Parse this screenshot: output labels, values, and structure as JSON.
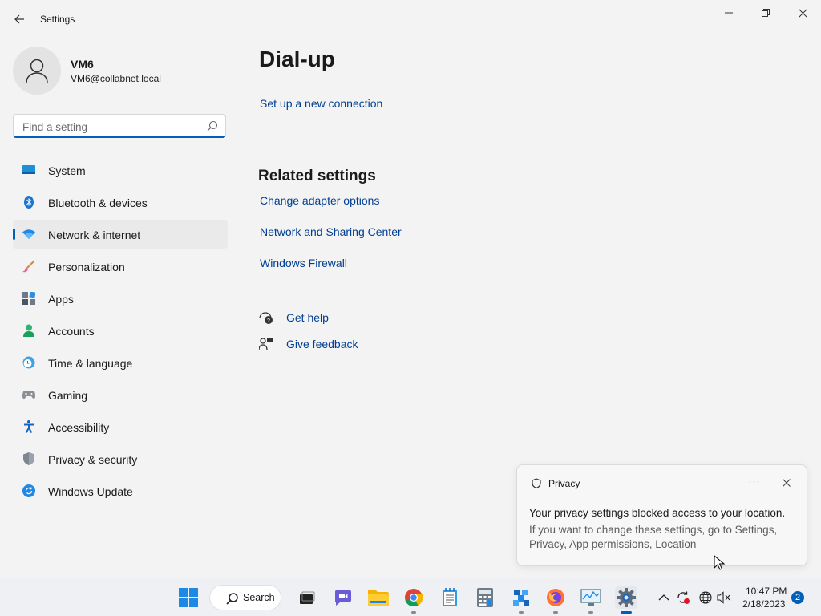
{
  "window": {
    "title": "Settings"
  },
  "profile": {
    "name": "VM6",
    "email": "VM6@collabnet.local"
  },
  "search": {
    "placeholder": "Find a setting",
    "value": ""
  },
  "sidebar": {
    "items": [
      {
        "label": "System",
        "icon": "system-icon"
      },
      {
        "label": "Bluetooth & devices",
        "icon": "bluetooth-icon"
      },
      {
        "label": "Network & internet",
        "icon": "wifi-icon",
        "active": true
      },
      {
        "label": "Personalization",
        "icon": "brush-icon"
      },
      {
        "label": "Apps",
        "icon": "apps-icon"
      },
      {
        "label": "Accounts",
        "icon": "accounts-icon"
      },
      {
        "label": "Time & language",
        "icon": "clock-globe-icon"
      },
      {
        "label": "Gaming",
        "icon": "gamepad-icon"
      },
      {
        "label": "Accessibility",
        "icon": "accessibility-icon"
      },
      {
        "label": "Privacy & security",
        "icon": "shield-icon"
      },
      {
        "label": "Windows Update",
        "icon": "update-icon"
      }
    ]
  },
  "main": {
    "title": "Dial-up",
    "setup_link": "Set up a new connection",
    "related": {
      "title": "Related settings",
      "links": [
        "Change adapter options",
        "Network and Sharing Center",
        "Windows Firewall"
      ]
    },
    "help": {
      "get_help": "Get help",
      "give_feedback": "Give feedback"
    }
  },
  "notification": {
    "app": "Privacy",
    "more": "···",
    "title": "Your privacy settings blocked access to your location.",
    "body": "If you want to change these settings, go to Settings, Privacy, App permissions, Location"
  },
  "taskbar": {
    "search_label": "Search",
    "time": "10:47 PM",
    "date": "2/18/2023",
    "notification_count": "2"
  },
  "colors": {
    "accent": "#005fb8",
    "link": "#003e92",
    "background": "#f3f3f3"
  }
}
